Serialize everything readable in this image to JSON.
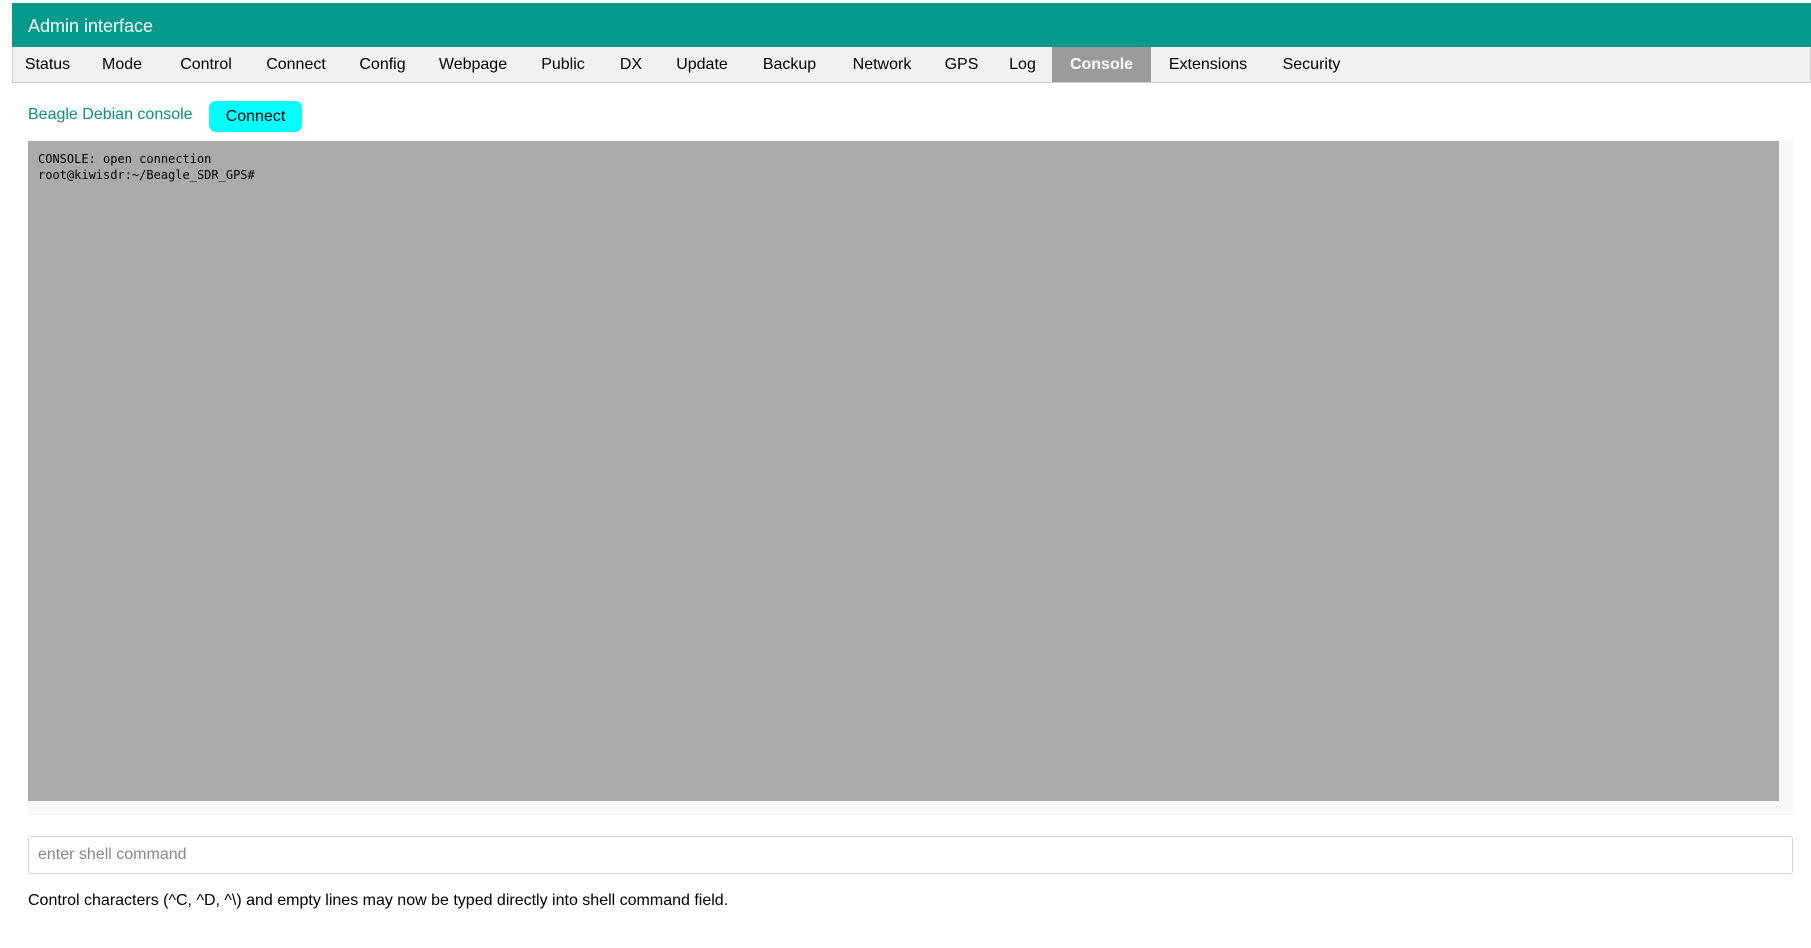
{
  "header": {
    "title": "Admin interface"
  },
  "tabs": [
    {
      "label": "Status"
    },
    {
      "label": "Mode"
    },
    {
      "label": "Control"
    },
    {
      "label": "Connect"
    },
    {
      "label": "Config"
    },
    {
      "label": "Webpage"
    },
    {
      "label": "Public"
    },
    {
      "label": "DX"
    },
    {
      "label": "Update"
    },
    {
      "label": "Backup"
    },
    {
      "label": "Network"
    },
    {
      "label": "GPS"
    },
    {
      "label": "Log"
    },
    {
      "label": "Console",
      "active": true
    },
    {
      "label": "Extensions"
    },
    {
      "label": "Security"
    }
  ],
  "console": {
    "label": "Beagle Debian console",
    "connect_label": "Connect",
    "lines": [
      "CONSOLE: open connection",
      "root@kiwisdr:~/Beagle_SDR_GPS#"
    ]
  },
  "shell": {
    "placeholder": "enter shell command",
    "value": ""
  },
  "help_text": "Control characters (^C, ^D, ^\\) and empty lines may now be typed directly into shell command field.",
  "colors": {
    "header_bg": "#03998b",
    "active_tab_bg": "#9b9b9b",
    "connect_button_bg": "#00ffff",
    "console_bg": "#aaaaaa",
    "label_color": "#0a8f84"
  }
}
